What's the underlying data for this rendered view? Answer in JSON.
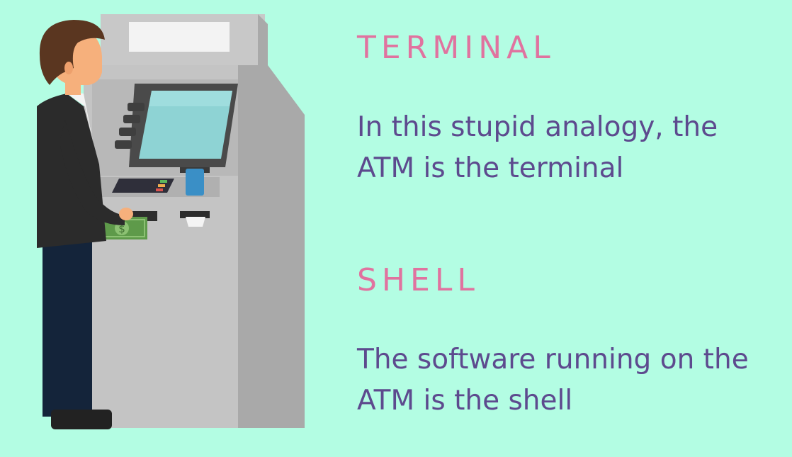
{
  "terminal": {
    "heading": "TERMINAL",
    "lines": [
      "In this stupid analogy, the",
      "ATM is the terminal"
    ]
  },
  "shell": {
    "heading": "SHELL",
    "lines": [
      "The software running on the",
      "ATM is the shell"
    ]
  },
  "colors": {
    "background": "#b3fde3",
    "heading": "#e0739f",
    "body": "#5d4a8e"
  },
  "illustration": {
    "subject": "man-using-atm",
    "icons": [
      "atm-machine",
      "person",
      "cash-banknote",
      "bank-card",
      "receipt"
    ]
  }
}
